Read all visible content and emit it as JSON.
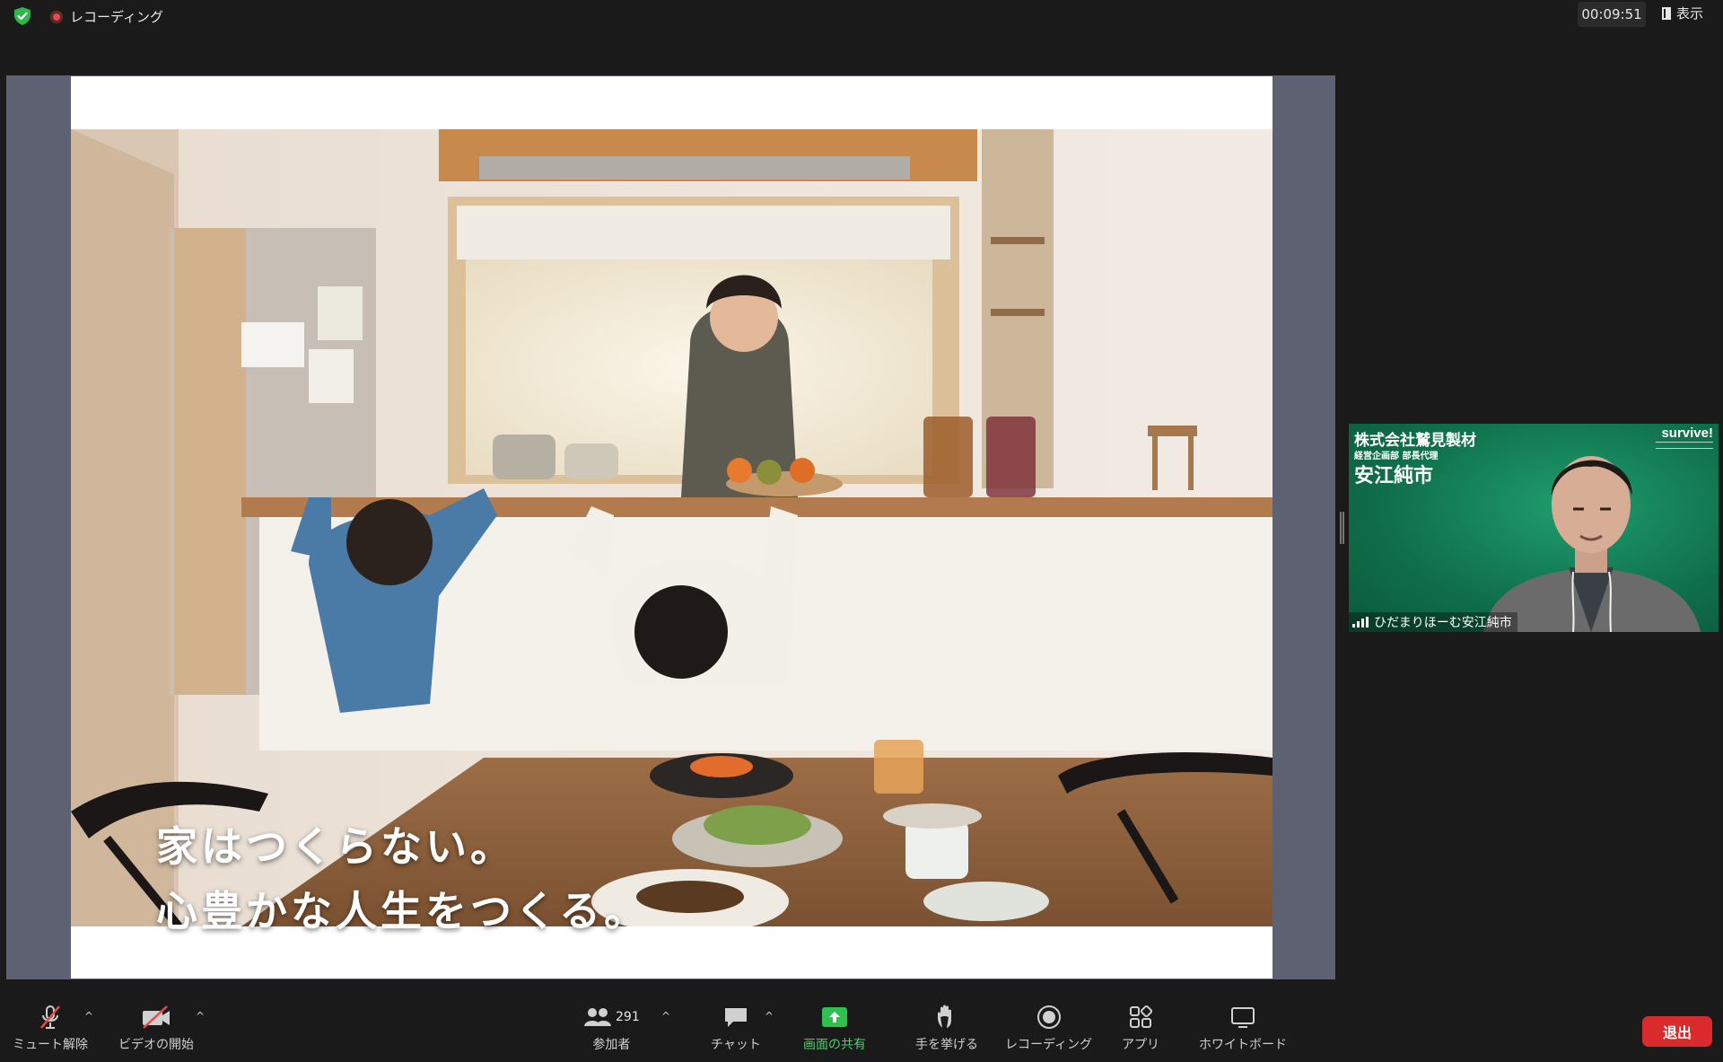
{
  "topbar": {
    "security_icon": "shield-check-icon",
    "recording_label": "レコーディング",
    "timer": "00:09:51",
    "view_label": "表示"
  },
  "shared_slide": {
    "headline_line1": "家はつくらない。",
    "headline_line2": "心豊かな人生をつくる。"
  },
  "video_tile": {
    "company": "株式会社鷲見製材",
    "department": "経営企画部 部長代理",
    "person": "安江純市",
    "brand": "survive!",
    "participant_name": "ひだまりほーむ安江純市"
  },
  "toolbar": {
    "unmute_label": "ミュート解除",
    "start_video_label": "ビデオの開始",
    "participants_label": "参加者",
    "participants_count": "291",
    "chat_label": "チャット",
    "share_screen_label": "画面の共有",
    "raise_hand_label": "手を挙げる",
    "recording_label": "レコーディング",
    "apps_label": "アプリ",
    "whiteboard_label": "ホワイトボード",
    "leave_label": "退出"
  },
  "colors": {
    "background": "#1a1a1a",
    "share_frame": "#5e6172",
    "share_green": "#4ad06a",
    "leave_red": "#d92b2b",
    "tile_green": "#12805a"
  }
}
